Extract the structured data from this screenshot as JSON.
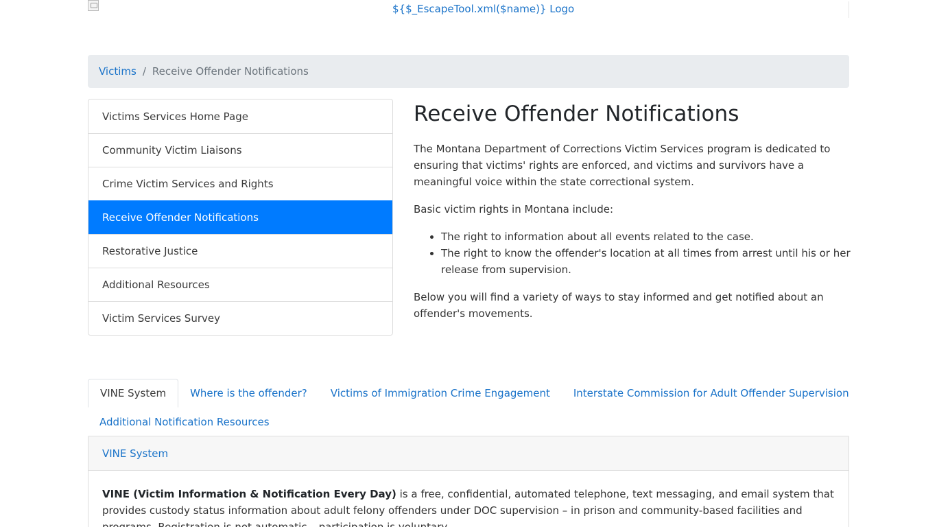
{
  "header": {
    "logo_text": "${$_EscapeTool.xml($name)} Logo"
  },
  "breadcrumb": {
    "parent": "Victims",
    "separator": "/",
    "current": "Receive Offender Notifications"
  },
  "sidebar": {
    "items": [
      {
        "label": "Victims Services Home Page"
      },
      {
        "label": "Community Victim Liaisons"
      },
      {
        "label": "Crime Victim Services and Rights"
      },
      {
        "label": "Receive Offender Notifications"
      },
      {
        "label": "Restorative Justice"
      },
      {
        "label": "Additional Resources"
      },
      {
        "label": "Victim Services Survey"
      }
    ],
    "active_index": 3
  },
  "main": {
    "title": "Receive Offender Notifications",
    "intro": "The Montana Department of Corrections Victim Services program is dedicated to ensuring that victims' rights are enforced, and victims and survivors have a meaningful voice within the state correctional system.",
    "rights_lead": "Basic victim rights in Montana include:",
    "rights": [
      "The right to information about all events related to the case.",
      "The right to know the offender's location at all times from arrest until his or her release from supervision."
    ],
    "outro": "Below you will find a variety of ways to stay informed and get notified about an offender's movements."
  },
  "tabs": {
    "items": [
      {
        "label": "VINE System"
      },
      {
        "label": "Where is the offender?"
      },
      {
        "label": "Victims of Immigration Crime Engagement"
      },
      {
        "label": "Interstate Commission for Adult Offender Supervision"
      },
      {
        "label": "Additional Notification Resources"
      }
    ],
    "active_index": 0
  },
  "panel": {
    "header": "VINE System",
    "body_strong": "VINE (Victim Information & Notification Every Day)",
    "body_rest": " is a free, confidential, automated telephone, text messaging, and email system that provides custody status information about adult felony offenders under DOC supervision – in prison and community-based facilities and programs. Registration is not automatic – participation is voluntary."
  }
}
